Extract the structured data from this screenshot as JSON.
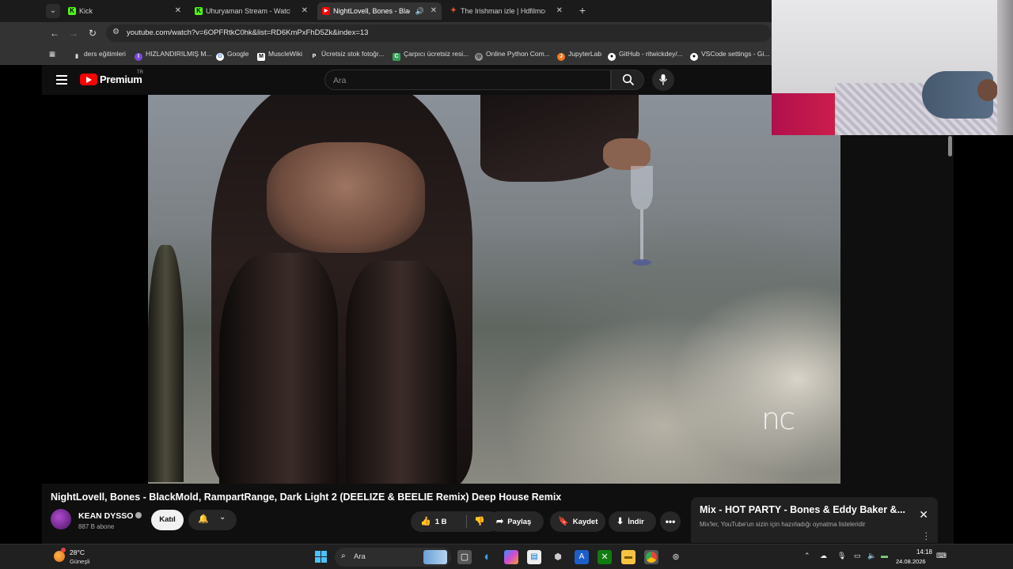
{
  "browser": {
    "tabs": [
      {
        "title": "Kick",
        "favicon": "kick-icon",
        "color": "#53fc18",
        "active": false
      },
      {
        "title": "Uhuryaman Stream - Watch Liv",
        "favicon": "kick-icon",
        "color": "#53fc18",
        "active": false
      },
      {
        "title": "NightLovell, Bones - BlackM",
        "favicon": "youtube-icon",
        "color": "#ff0000",
        "active": true
      },
      {
        "title": "The Irishman izle | Hdfilmcehen",
        "favicon": "film-icon",
        "color": "#e04a2a",
        "active": false
      }
    ],
    "url": "youtube.com/watch?v=6OPFRtkC0hk&list=RD6KmPxFhD5Zk&index=13",
    "bookmarks": [
      "ders eğitimleri",
      "HIZLANDIRILMIŞ M...",
      "Google",
      "MuscleWiki",
      "Ücretsiz stok fotoğr...",
      "Çarpıcı ücretsiz resi...",
      "Online Python Com...",
      "JupyterLab",
      "GitHub - ritwickdey/...",
      "VSCode settings - Gi..."
    ]
  },
  "youtube": {
    "logo_text": "Premium",
    "region": "TR",
    "search_placeholder": "Ara",
    "video_watermark": "nc",
    "video_title": "NightLovell, Bones - BlackMold, RampartRange, Dark Light 2 (DEELIZE & BEELIE Remix) Deep House Remix",
    "channel_name": "KEAN DYSSO",
    "subscribers": "887 B abone",
    "join_label": "Katıl",
    "likes": "1 B",
    "share_label": "Paylaş",
    "save_label": "Kaydet",
    "download_label": "İndir"
  },
  "mix": {
    "title": "Mix - HOT PARTY - Bones & Eddy Baker &...",
    "subtitle": "Mix'ler, YouTube'un sizin için hazırladığı oynatma listeleridir"
  },
  "taskbar": {
    "temperature": "28°C",
    "weather": "Güneşli",
    "search_label": "Ara",
    "time": "14:18",
    "date": "24.08.2026"
  },
  "colors": {
    "youtube_red": "#ff0000",
    "kick_green": "#53fc18",
    "windows_accent": "#4cc2ff"
  }
}
